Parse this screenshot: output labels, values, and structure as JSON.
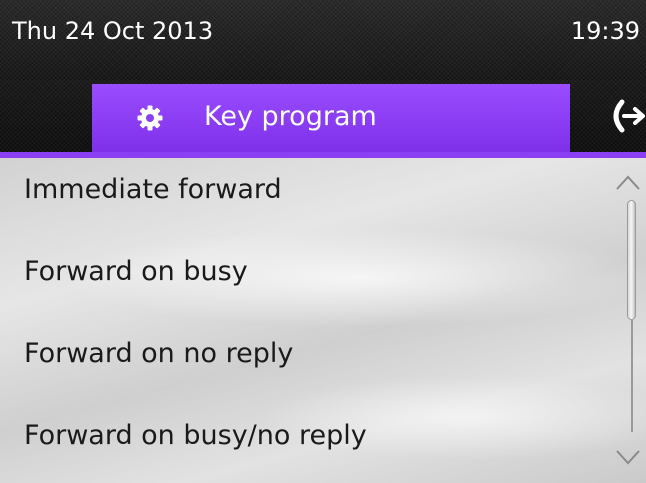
{
  "status_bar": {
    "date": "Thu 24 Oct 2013",
    "time": "19:39"
  },
  "tabs": {
    "active": {
      "label": "Key program",
      "icon": "gear-icon"
    },
    "next_icon": "exit-arrow-icon"
  },
  "menu": {
    "items": [
      {
        "label": "Immediate forward"
      },
      {
        "label": "Forward on busy"
      },
      {
        "label": "Forward on no reply"
      },
      {
        "label": "Forward on busy/no reply"
      }
    ]
  },
  "colors": {
    "accent": "#8a3ff2",
    "tab_active": "#9a4cff",
    "status_bar": "#1c1c1c",
    "text": "#1a1a1a"
  }
}
